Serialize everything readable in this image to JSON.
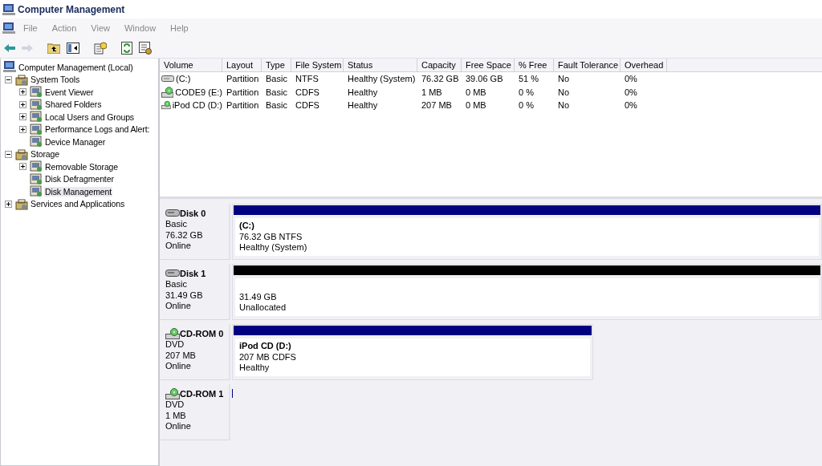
{
  "window": {
    "title": "Computer Management"
  },
  "menu": [
    "File",
    "Action",
    "View",
    "Window",
    "Help"
  ],
  "tree": [
    {
      "label": "Computer Management (Local)",
      "children": [
        {
          "label": "System Tools",
          "expanded": true,
          "children": [
            {
              "label": "Event Viewer",
              "expanded": false
            },
            {
              "label": "Shared Folders",
              "expanded": false
            },
            {
              "label": "Local Users and Groups",
              "expanded": false
            },
            {
              "label": "Performance Logs and Alert:",
              "expanded": false
            },
            {
              "label": "Device Manager"
            }
          ]
        },
        {
          "label": "Storage",
          "expanded": true,
          "children": [
            {
              "label": "Removable Storage",
              "expanded": false
            },
            {
              "label": "Disk Defragmenter"
            },
            {
              "label": "Disk Management",
              "selected": true
            }
          ]
        },
        {
          "label": "Services and Applications",
          "expanded": false
        }
      ]
    }
  ],
  "table": {
    "columns": [
      "Volume",
      "Layout",
      "Type",
      "File System",
      "Status",
      "Capacity",
      "Free Space",
      "% Free",
      "Fault Tolerance",
      "Overhead"
    ],
    "rows": [
      {
        "kind": "hdd",
        "cells": [
          "(C:)",
          "Partition",
          "Basic",
          "NTFS",
          "Healthy (System)",
          "76.32 GB",
          "39.06 GB",
          "51 %",
          "No",
          "0%"
        ]
      },
      {
        "kind": "cd",
        "cells": [
          "CODE9 (E:)",
          "Partition",
          "Basic",
          "CDFS",
          "Healthy",
          "1 MB",
          "0 MB",
          "0 %",
          "No",
          "0%"
        ]
      },
      {
        "kind": "cd",
        "cells": [
          "iPod CD (D:)",
          "Partition",
          "Basic",
          "CDFS",
          "Healthy",
          "207 MB",
          "0 MB",
          "0 %",
          "No",
          "0%"
        ]
      }
    ]
  },
  "disks": [
    {
      "kind": "hdd",
      "name": "Disk 0",
      "type": "Basic",
      "size": "76.32 GB",
      "status": "Online",
      "partition": {
        "label": "(C:)",
        "detail": "76.32 GB NTFS",
        "status": "Healthy (System)",
        "color": "#000080"
      }
    },
    {
      "kind": "hdd",
      "name": "Disk 1",
      "type": "Basic",
      "size": "31.49 GB",
      "status": "Online",
      "partition": {
        "detail": "31.49 GB",
        "status": "Unallocated",
        "color": "#000000"
      }
    },
    {
      "kind": "cdrom",
      "name": "CD-ROM 0",
      "type": "DVD",
      "size": "207 MB",
      "status": "Online",
      "partition": {
        "label": "iPod CD  (D:)",
        "detail": "207 MB CDFS",
        "status": "Healthy",
        "color": "#000080"
      }
    },
    {
      "kind": "cdrom",
      "name": "CD-ROM 1",
      "type": "DVD",
      "size": "1 MB",
      "status": "Online"
    }
  ]
}
